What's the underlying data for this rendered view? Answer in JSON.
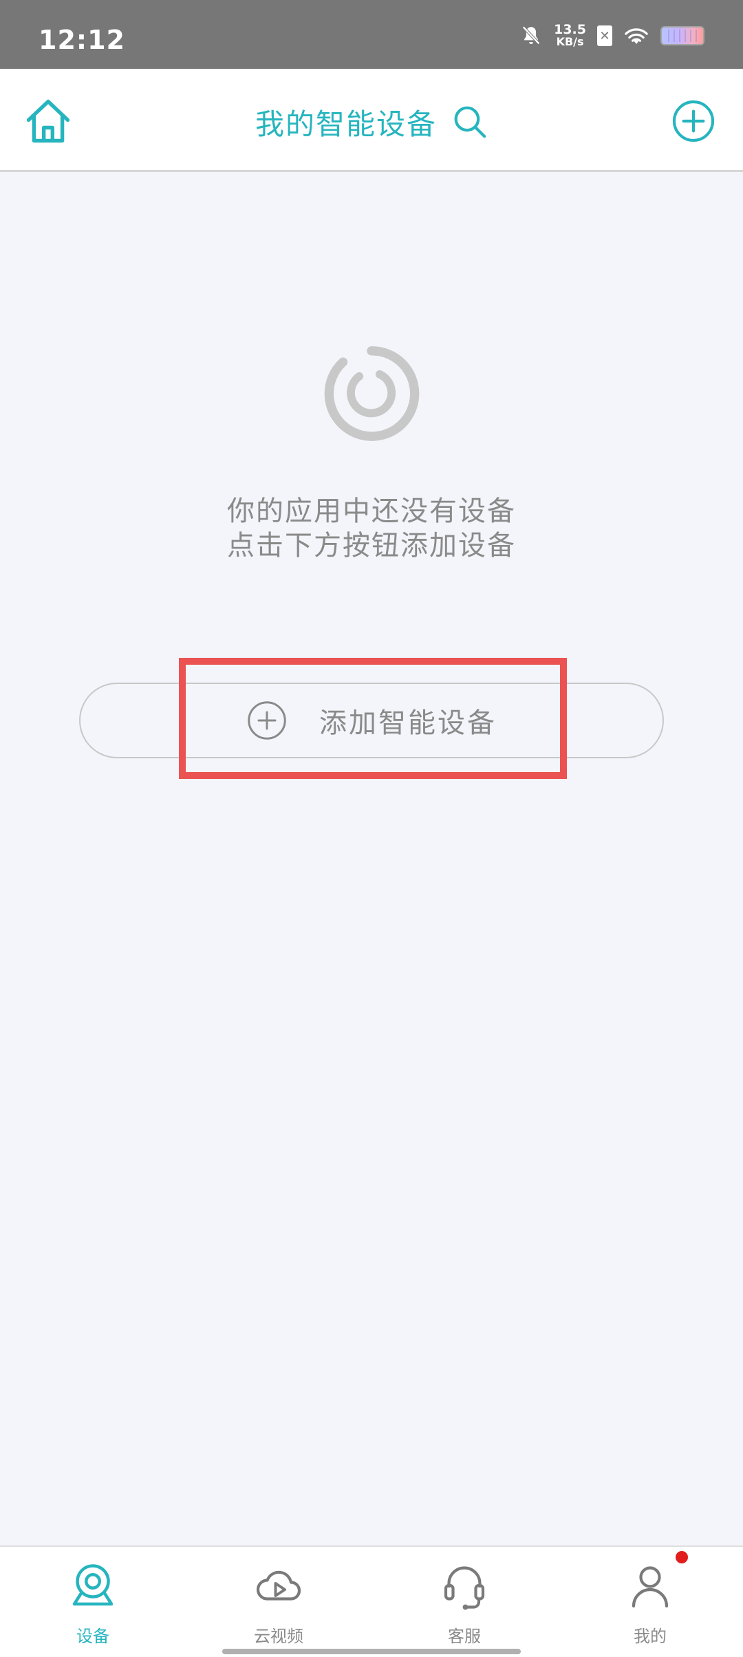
{
  "status_bar": {
    "time": "12:12",
    "net_speed_value": "13.5",
    "net_speed_unit": "KB/s",
    "sim_badge": "✕"
  },
  "header": {
    "title": "我的智能设备"
  },
  "empty_state": {
    "line1": "你的应用中还没有设备",
    "line2": "点击下方按钮添加设备"
  },
  "add_button": {
    "label": "添加智能设备"
  },
  "nav": {
    "items": [
      {
        "label": "设备",
        "icon": "camera-icon",
        "active": true
      },
      {
        "label": "云视频",
        "icon": "cloud-play-icon",
        "active": false
      },
      {
        "label": "客服",
        "icon": "headset-icon",
        "active": false
      },
      {
        "label": "我的",
        "icon": "person-icon",
        "active": false
      }
    ]
  },
  "colors": {
    "accent": "#26b5bf",
    "highlight": "#ea5351",
    "muted_text": "#8a8a8a",
    "background": "#f4f5fa"
  }
}
